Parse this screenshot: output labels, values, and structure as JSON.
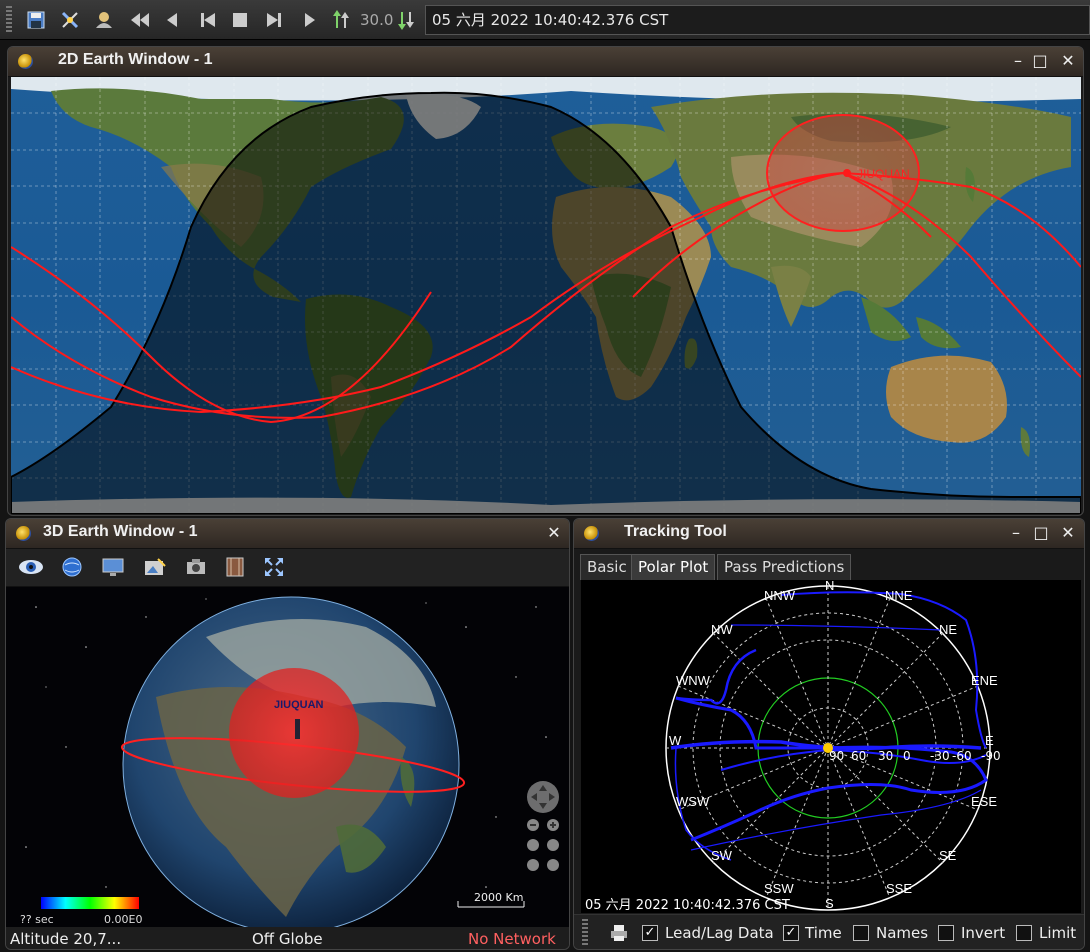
{
  "toolbar": {
    "step_value": "30.0",
    "datetime": "05 六月 2022 10:40:42.376 CST",
    "colors": {
      "accent_green": "#7fd26a"
    }
  },
  "earth2d": {
    "title": "2D Earth Window - 1",
    "station_label": "JIUQUAN"
  },
  "earth3d": {
    "title": "3D Earth Window - 1",
    "station_label": "JIUQUAN",
    "legend_left": "?? sec",
    "legend_right": "0.00E0",
    "scale_label": "2000 Km",
    "status_altitude": "Altitude  20,7...",
    "status_mode": "Off Globe",
    "status_network": "No Network",
    "colors": {
      "network": "#ff6060"
    }
  },
  "tracking": {
    "title": "Tracking Tool",
    "tabs": [
      "Basic",
      "Polar Plot",
      "Pass Predictions"
    ],
    "directions": {
      "N": "N",
      "NNE": "NNE",
      "NE": "NE",
      "ENE": "ENE",
      "E": "E",
      "ESE": "ESE",
      "SE": "SE",
      "SSE": "SSE",
      "S": "S",
      "SSW": "SSW",
      "SW": "SW",
      "WSW": "WSW",
      "W": "W",
      "WNW": "WNW",
      "NW": "NW",
      "NNW": "NNW"
    },
    "ticks": [
      "90",
      "60",
      "30",
      "0",
      "-30",
      "-60",
      "-90"
    ],
    "timestamp": "05 六月 2022 10:40:42.376 CST",
    "checkboxes": [
      {
        "label": "Lead/Lag Data",
        "checked": true
      },
      {
        "label": "Time",
        "checked": true
      },
      {
        "label": "Names",
        "checked": false
      },
      {
        "label": "Invert",
        "checked": false
      },
      {
        "label": "Limit",
        "checked": false
      }
    ]
  }
}
